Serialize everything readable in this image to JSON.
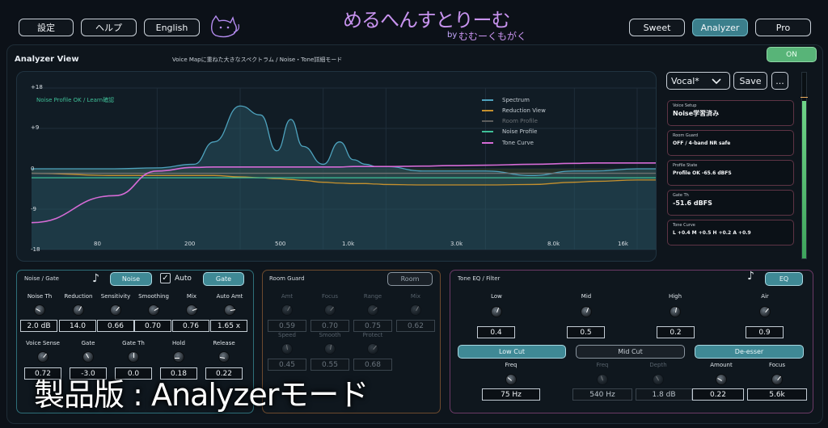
{
  "top": {
    "settings": "設定",
    "help": "ヘルプ",
    "english": "English",
    "modes": [
      "Sweet",
      "Analyzer",
      "Pro"
    ],
    "logo_main": "めるへんすとりーむ",
    "logo_by": "by",
    "logo_author": "むむーくもがく"
  },
  "header": {
    "title": "Analyzer View",
    "subtitle": "Voice Mapに重ねた大きなスペクトラム / Noise・Tone詳細モード",
    "on_label": "ON"
  },
  "plot": {
    "status": "Noise Profile OK / Learn確認",
    "y_ticks": [
      "+18",
      "+9",
      "0",
      "-9",
      "-18"
    ],
    "x_ticks": [
      "80",
      "200",
      "500",
      "1.0k",
      "3.0k",
      "8.0k",
      "16k"
    ],
    "legend": [
      "Spectrum",
      "Reduction View",
      "Room Profile",
      "Noise Profile",
      "Tone Curve"
    ]
  },
  "chart_data": {
    "type": "line",
    "xlabel": "",
    "ylabel": "",
    "xscale": "log",
    "ylim": [
      -18,
      18
    ],
    "x": [
      20,
      50,
      80,
      120,
      150,
      200,
      250,
      300,
      350,
      400,
      500,
      600,
      700,
      800,
      900,
      1000,
      1500,
      2000,
      3000,
      5000,
      8000,
      10000,
      16000,
      20000
    ],
    "series": [
      {
        "name": "Spectrum",
        "values": [
          0,
          0,
          0.2,
          1,
          6,
          14,
          12,
          4,
          11,
          5,
          1,
          6,
          2,
          1,
          0.5,
          0.5,
          -0.5,
          -0.5,
          -0.5,
          -1.5,
          -0.5,
          -0.5,
          0,
          0
        ]
      },
      {
        "name": "Reduction View",
        "values": [
          -1,
          -1.5,
          -1.5,
          -1.5,
          -1.5,
          -1.8,
          -2,
          -2.2,
          -2.4,
          -2.6,
          -3,
          -3.2,
          -3.3,
          -3.3,
          -3.4,
          -3.5,
          -3.6,
          -3.6,
          -3.6,
          -3.5,
          -3,
          -2.8,
          -2.5,
          -2.5
        ]
      },
      {
        "name": "Room Profile",
        "values": [
          -1,
          -1,
          -1,
          -1,
          -1,
          -1,
          -1,
          -1,
          -1,
          -1,
          -1,
          -1,
          -1,
          -1,
          -1,
          -1,
          -1,
          -1,
          -1,
          -1,
          -1,
          -1,
          -1,
          -1
        ]
      },
      {
        "name": "Noise Profile",
        "values": [
          -2,
          -2,
          -2,
          -2,
          -2,
          -2,
          -2,
          -2,
          -2,
          -2,
          -2,
          -2,
          -2,
          -2,
          -2,
          -2,
          -2,
          -2,
          -2,
          -2,
          -2,
          -2,
          -2,
          -2
        ]
      },
      {
        "name": "Tone Curve",
        "values": [
          -12,
          -6,
          -0.5,
          0.3,
          0.4,
          0.4,
          0.4,
          0.4,
          0.4,
          0.4,
          0.4,
          0.4,
          0.5,
          0.5,
          0.5,
          0.5,
          0.6,
          0.7,
          0.8,
          1,
          1.2,
          1.3,
          1.3,
          1.3
        ]
      }
    ],
    "colors": [
      "#4ea3be",
      "#c5902e",
      "#6f7070",
      "#3fbf98",
      "#d66bd6"
    ]
  },
  "preset": {
    "name": "Vocal*",
    "save": "Save",
    "more": "..."
  },
  "cards": [
    {
      "title": "Voice Setup",
      "value": "Noise学習済み"
    },
    {
      "title": "Room Guard",
      "value": "OFF / 4-band NR safe"
    },
    {
      "title": "Profile State",
      "value": "Profile OK  -65.6 dBFS"
    },
    {
      "title": "Gate Th",
      "value": "-51.6 dBFS"
    },
    {
      "title": "Tone Curve",
      "value": "L +0.4  M +0.5  H +0.2  A +0.9"
    }
  ],
  "meter": {
    "level": 0.85
  },
  "noise": {
    "title": "Noise / Gate",
    "btn_noise": "Noise",
    "auto": "Auto",
    "btn_gate": "Gate",
    "row1": [
      {
        "label": "Noise Th",
        "value": "2.0 dB"
      },
      {
        "label": "Reduction",
        "value": "14.0"
      },
      {
        "label": "Sensitivity",
        "value": "0.66"
      },
      {
        "label": "Smoothing",
        "value": "0.70"
      },
      {
        "label": "Mix",
        "value": "0.76"
      },
      {
        "label": "Auto Amt",
        "value": "1.65 x"
      }
    ],
    "row2": [
      {
        "label": "Voice Sense",
        "value": "0.72"
      },
      {
        "label": "Gate",
        "value": "-3.0"
      },
      {
        "label": "Gate Th",
        "value": "0.0"
      },
      {
        "label": "Hold",
        "value": "0.18"
      },
      {
        "label": "Release",
        "value": "0.22"
      }
    ]
  },
  "room": {
    "title": "Room Guard",
    "btn": "Room",
    "row1": [
      {
        "label": "Amt",
        "value": "0.59"
      },
      {
        "label": "Focus",
        "value": "0.70"
      },
      {
        "label": "Range",
        "value": "0.75"
      },
      {
        "label": "Mix",
        "value": "0.62"
      }
    ],
    "row2": [
      {
        "label": "Speed",
        "value": "0.45"
      },
      {
        "label": "Smooth",
        "value": "0.55"
      },
      {
        "label": "Protect",
        "value": "0.68"
      }
    ]
  },
  "eq": {
    "title": "Tone EQ / Filter",
    "btn": "EQ",
    "bands": [
      {
        "label": "Low",
        "value": "0.4"
      },
      {
        "label": "Mid",
        "value": "0.5"
      },
      {
        "label": "High",
        "value": "0.2"
      },
      {
        "label": "Air",
        "value": "0.9"
      }
    ],
    "filters": [
      "Low Cut",
      "Mid Cut",
      "De-esser"
    ],
    "row2": [
      {
        "label": "Freq",
        "value": "75 Hz"
      },
      {
        "label": "Freq",
        "value": "540 Hz"
      },
      {
        "label": "Depth",
        "value": "1.8 dB"
      },
      {
        "label": "Amount",
        "value": "0.22"
      },
      {
        "label": "Focus",
        "value": "5.6k"
      }
    ]
  },
  "caption": "製品版 : Analyzerモード"
}
